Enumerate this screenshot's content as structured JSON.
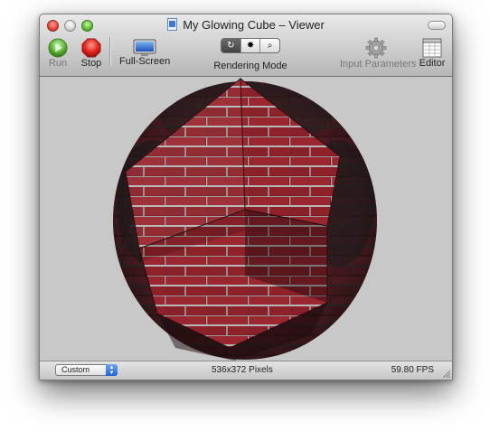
{
  "window": {
    "title": "My Glowing Cube – Viewer"
  },
  "toolbar": {
    "run_label": "Run",
    "stop_label": "Stop",
    "fullscreen_label": "Full-Screen",
    "rendering_mode_label": "Rendering Mode",
    "input_parameters_label": "Input Parameters",
    "editor_label": "Editor",
    "rendering_mode_icons": [
      "refresh-icon",
      "bulb-icon",
      "magnifier-icon"
    ]
  },
  "status": {
    "size_popup_value": "Custom",
    "dimensions": "536x372 Pixels",
    "fps": "59.80 FPS"
  },
  "colors": {
    "run_green": "#5cb535",
    "stop_red": "#e0241c",
    "brick_red": "#8e1f25",
    "content_bg": "#c8c8c8"
  }
}
